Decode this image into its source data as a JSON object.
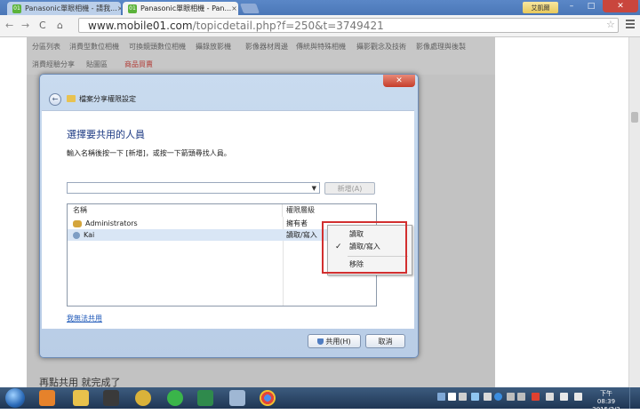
{
  "browser": {
    "tabs": [
      {
        "label": "Panasonic單眼相機 - 請我...",
        "active": false
      },
      {
        "label": "Panasonic單眼相機 - Pan...",
        "active": true
      }
    ],
    "user_badge": "艾凱爾",
    "url_host": "www.mobile01.com",
    "url_path": "/topicdetail.php?f=250&t=3749421"
  },
  "site_nav": {
    "items": [
      "分區列表",
      "消費型數位相機",
      "可換鏡頭數位相機",
      "攝錄放影機",
      "影像器材周邊",
      "傳統與特殊相機",
      "攝影觀念及技術",
      "影像處理與後製",
      "消費經驗分享",
      "貼圖區",
      "商品買賣"
    ]
  },
  "dialog": {
    "title": "檔案分享權限設定",
    "heading": "選擇要共用的人員",
    "instruction": "輸入名稱後按一下 [新增]，或按一下箭頭尋找人員。",
    "add_button": "新增(A)",
    "columns": {
      "name": "名稱",
      "permission": "權限層級"
    },
    "rows": [
      {
        "name": "Administrators",
        "permission": "擁有者"
      },
      {
        "name": "Kai",
        "permission": "讀取/寫入"
      }
    ],
    "link": "我無法共用",
    "share_button": "共用(H)",
    "cancel_button": "取消"
  },
  "context_menu": {
    "items": [
      {
        "label": "讀取",
        "checked": false
      },
      {
        "label": "讀取/寫入",
        "checked": true
      },
      {
        "label": "移除",
        "checked": false
      }
    ]
  },
  "page_text": "再點共用 就完成了",
  "taskbar": {
    "time": "下午 08:39",
    "date": "2015/2/2"
  }
}
